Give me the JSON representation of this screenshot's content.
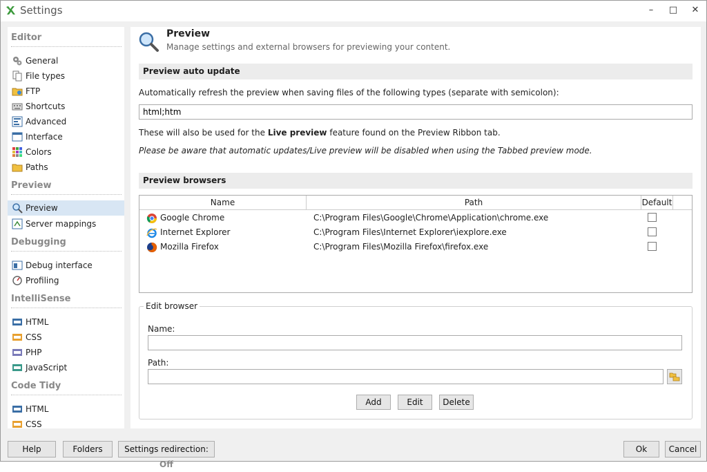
{
  "window": {
    "title": "Settings",
    "min_glyph": "–",
    "max_glyph": "□",
    "close_glyph": "✕"
  },
  "sidebar": {
    "sections": [
      {
        "label": "Editor"
      },
      {
        "label": "Preview"
      },
      {
        "label": "Debugging"
      },
      {
        "label": "IntelliSense"
      },
      {
        "label": "Code Tidy"
      }
    ],
    "items": [
      {
        "label": "General"
      },
      {
        "label": "File types"
      },
      {
        "label": "FTP"
      },
      {
        "label": "Shortcuts"
      },
      {
        "label": "Advanced"
      },
      {
        "label": "Interface"
      },
      {
        "label": "Colors"
      },
      {
        "label": "Paths"
      },
      {
        "label": "Preview"
      },
      {
        "label": "Server mappings"
      },
      {
        "label": "Debug interface"
      },
      {
        "label": "Profiling"
      },
      {
        "label": "HTML"
      },
      {
        "label": "CSS"
      },
      {
        "label": "PHP"
      },
      {
        "label": "JavaScript"
      },
      {
        "label": "HTML"
      },
      {
        "label": "CSS"
      }
    ],
    "selected": "Preview"
  },
  "page": {
    "title": "Preview",
    "subtitle": "Manage settings and external browsers for previewing your content."
  },
  "auto_update": {
    "heading": "Preview auto update",
    "description": "Automatically refresh the preview when saving files of the following types (separate with semicolon):",
    "file_types_value": "html;htm",
    "note_prefix": "These will also be used for the ",
    "note_bold": "Live preview",
    "note_suffix": " feature found on the Preview Ribbon tab.",
    "warning": "Please be aware that automatic updates/Live preview will be disabled when using the Tabbed preview mode."
  },
  "browsers": {
    "heading": "Preview browsers",
    "columns": {
      "name": "Name",
      "path": "Path",
      "default": "Default"
    },
    "rows": [
      {
        "name": "Google Chrome",
        "path": "C:\\Program Files\\Google\\Chrome\\Application\\chrome.exe",
        "icon": "chrome-icon",
        "default": false
      },
      {
        "name": "Internet Explorer",
        "path": "C:\\Program Files\\Internet Explorer\\iexplore.exe",
        "icon": "ie-icon",
        "default": false
      },
      {
        "name": "Mozilla Firefox",
        "path": "C:\\Program Files\\Mozilla Firefox\\firefox.exe",
        "icon": "firefox-icon",
        "default": false
      }
    ]
  },
  "edit_browser": {
    "legend": "Edit browser",
    "name_label": "Name:",
    "name_value": "",
    "path_label": "Path:",
    "path_value": "",
    "add_label": "Add",
    "edit_label": "Edit",
    "delete_label": "Delete"
  },
  "footer": {
    "help_label": "Help",
    "folders_label": "Folders",
    "redirection_label": "Settings redirection: ",
    "redirection_state": "Off",
    "ok_label": "Ok",
    "cancel_label": "Cancel"
  },
  "colors": {
    "accent": "#d8e6f4",
    "panel_bg": "#f0f0f0",
    "group_head": "#ececec"
  }
}
